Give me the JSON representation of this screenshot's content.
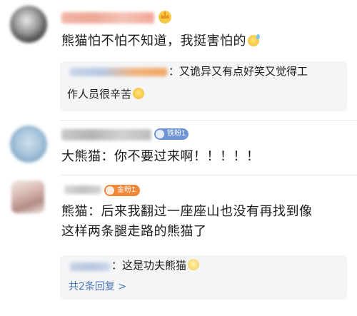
{
  "comments": [
    {
      "text": "熊猫怕不怕不知道，我挺害怕的",
      "emoji": "sweat-smile-emoji",
      "reply": {
        "text_line1": "：又诡异又有点好笑又觉得工",
        "text_line2": "作人员很辛苦"
      }
    },
    {
      "badge": "铁粉1",
      "text": "大熊猫：你不要过来啊！！！！！"
    },
    {
      "badge": "金粉1",
      "text_line1": "熊猫：后来我翻过一座座山也没有再找到像",
      "text_line2": "这样两条腿走路的熊猫了",
      "reply": {
        "text": "：这是功夫熊猫"
      },
      "more_replies": "共2条回复 >"
    }
  ],
  "colors": {
    "iron_badge": "#6f93d6",
    "gold_badge": "#f0883a",
    "link": "#4a75b8"
  }
}
